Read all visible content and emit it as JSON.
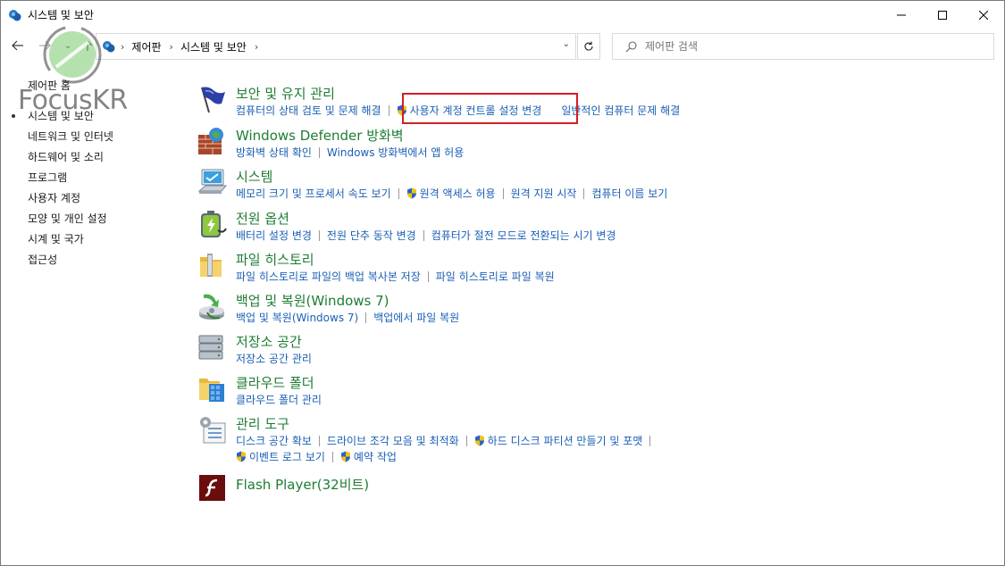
{
  "window": {
    "title": "시스템 및 보안"
  },
  "address": {
    "segments": [
      "제어판",
      "시스템 및 보안"
    ]
  },
  "search": {
    "placeholder": "제어판 검색"
  },
  "watermark": {
    "text": "FocusKR"
  },
  "sidebar": {
    "items": [
      {
        "label": "제어판 홈"
      },
      {
        "label": "시스템 및 보안",
        "selected": true
      },
      {
        "label": "네트워크 및 인터넷"
      },
      {
        "label": "하드웨어 및 소리"
      },
      {
        "label": "프로그램"
      },
      {
        "label": "사용자 계정"
      },
      {
        "label": "모양 및 개인 설정"
      },
      {
        "label": "시계 및 국가"
      },
      {
        "label": "접근성"
      }
    ]
  },
  "categories": [
    {
      "title": "보안 및 유지 관리",
      "icon": "flag-icon",
      "links": [
        "컴퓨터의 상태 검토 및 문제 해결",
        "사용자 계정 컨트롤 설정 변경",
        "일반적인 컴퓨터 문제 해결"
      ]
    },
    {
      "title": "Windows Defender 방화벽",
      "icon": "firewall-icon",
      "links": [
        "방화벽 상태 확인",
        "Windows 방화벽에서 앱 허용"
      ]
    },
    {
      "title": "시스템",
      "icon": "system-icon",
      "links": [
        "메모리 크기 및 프로세서 속도 보기",
        "원격 액세스 허용",
        "원격 지원 시작",
        "컴퓨터 이름 보기"
      ]
    },
    {
      "title": "전원 옵션",
      "icon": "power-options-icon",
      "links": [
        "배터리 설정 변경",
        "전원 단추 동작 변경",
        "컴퓨터가 절전 모드로 전환되는 시기 변경"
      ]
    },
    {
      "title": "파일 히스토리",
      "icon": "file-history-icon",
      "links": [
        "파일 히스토리로 파일의 백업 복사본 저장",
        "파일 히스토리로 파일 복원"
      ]
    },
    {
      "title": "백업 및 복원(Windows 7)",
      "icon": "backup-restore-icon",
      "links": [
        "백업 및 복원(Windows 7)",
        "백업에서 파일 복원"
      ]
    },
    {
      "title": "저장소 공간",
      "icon": "storage-spaces-icon",
      "links": [
        "저장소 공간 관리"
      ]
    },
    {
      "title": "클라우드 폴더",
      "icon": "work-folders-icon",
      "links": [
        "클라우드 폴더 관리"
      ]
    },
    {
      "title": "관리 도구",
      "icon": "admin-tools-icon",
      "links": [
        "디스크 공간 확보",
        "드라이브 조각 모음 및 최적화",
        "하드 디스크 파티션 만들기 및 포맷",
        "이벤트 로그 보기",
        "예약 작업"
      ]
    },
    {
      "title": "Flash Player(32비트)",
      "icon": "flash-player-icon",
      "links": []
    }
  ],
  "colors": {
    "link": "#1a5fb4",
    "category_title": "#1e7d32",
    "highlight": "#d41e27"
  }
}
